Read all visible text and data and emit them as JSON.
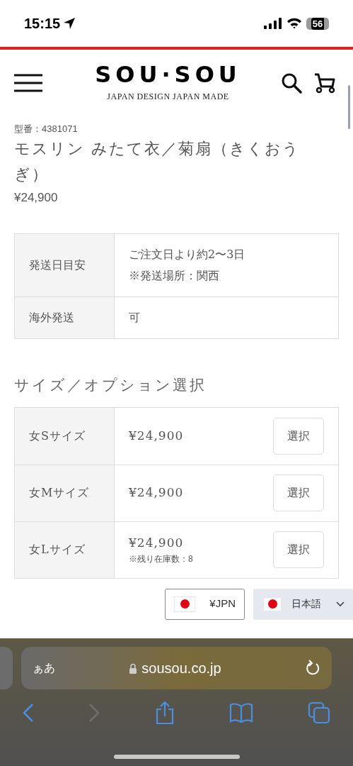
{
  "status_bar": {
    "time": "15:15",
    "battery": "56"
  },
  "header": {
    "logo": "SOU·SOU",
    "tagline": "JAPAN DESIGN JAPAN MADE"
  },
  "product": {
    "model_number": "型番：4381071",
    "title": "モスリン みたて衣／菊扇（きくおうぎ）",
    "price": "¥24,900"
  },
  "shipping_table": [
    {
      "label": "発送日目安",
      "lines": [
        "ご注文日より約2〜3日",
        "※発送場所：関西"
      ]
    },
    {
      "label": "海外発送",
      "lines": [
        "可"
      ]
    }
  ],
  "options": {
    "heading": "サイズ／オプション選択",
    "rows": [
      {
        "label": "女Sサイズ",
        "price": "¥24,900",
        "button": "選択"
      },
      {
        "label": "女Mサイズ",
        "price": "¥24,900",
        "button": "選択"
      },
      {
        "label": "女Lサイズ",
        "price": "¥24,900",
        "stock": "※残り在庫数：8",
        "button": "選択"
      }
    ]
  },
  "currency": {
    "label": "¥JPN"
  },
  "language": {
    "label": "日本語"
  },
  "browser": {
    "text_size": "ぁあ",
    "url": "sousou.co.jp"
  }
}
